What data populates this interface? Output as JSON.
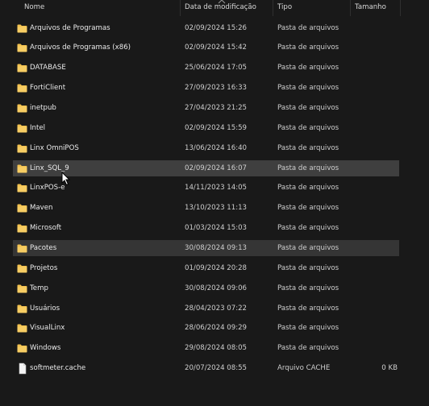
{
  "columns": {
    "name": "Nome",
    "date": "Data de modificação",
    "type": "Tipo",
    "size": "Tamanho"
  },
  "sort": {
    "column": "name",
    "icon": "chevron-up-icon"
  },
  "files": [
    {
      "name": "Arquivos de Programas",
      "date": "02/09/2024 15:26",
      "type": "Pasta de arquivos",
      "size": "",
      "icon": "folder-icon"
    },
    {
      "name": "Arquivos de Programas (x86)",
      "date": "02/09/2024 15:42",
      "type": "Pasta de arquivos",
      "size": "",
      "icon": "folder-icon"
    },
    {
      "name": "DATABASE",
      "date": "25/06/2024 17:05",
      "type": "Pasta de arquivos",
      "size": "",
      "icon": "folder-icon"
    },
    {
      "name": "FortiClient",
      "date": "27/09/2023 16:33",
      "type": "Pasta de arquivos",
      "size": "",
      "icon": "folder-icon"
    },
    {
      "name": "inetpub",
      "date": "27/04/2023 21:25",
      "type": "Pasta de arquivos",
      "size": "",
      "icon": "folder-icon"
    },
    {
      "name": "Intel",
      "date": "02/09/2024 15:59",
      "type": "Pasta de arquivos",
      "size": "",
      "icon": "folder-icon"
    },
    {
      "name": "Linx OmniPOS",
      "date": "13/06/2024 16:40",
      "type": "Pasta de arquivos",
      "size": "",
      "icon": "folder-icon"
    },
    {
      "name": "Linx_SQL_9",
      "date": "02/09/2024 16:07",
      "type": "Pasta de arquivos",
      "size": "",
      "icon": "folder-icon",
      "state": "hover"
    },
    {
      "name": "LinxPOS-e",
      "date": "14/11/2023 14:05",
      "type": "Pasta de arquivos",
      "size": "",
      "icon": "folder-icon"
    },
    {
      "name": "Maven",
      "date": "13/10/2023 11:13",
      "type": "Pasta de arquivos",
      "size": "",
      "icon": "folder-icon"
    },
    {
      "name": "Microsoft",
      "date": "01/03/2024 15:03",
      "type": "Pasta de arquivos",
      "size": "",
      "icon": "folder-icon"
    },
    {
      "name": "Pacotes",
      "date": "30/08/2024 09:13",
      "type": "Pasta de arquivos",
      "size": "",
      "icon": "folder-icon",
      "state": "selected"
    },
    {
      "name": "Projetos",
      "date": "01/09/2024 20:28",
      "type": "Pasta de arquivos",
      "size": "",
      "icon": "folder-icon"
    },
    {
      "name": "Temp",
      "date": "30/08/2024 09:06",
      "type": "Pasta de arquivos",
      "size": "",
      "icon": "folder-icon"
    },
    {
      "name": "Usuários",
      "date": "28/04/2023 07:22",
      "type": "Pasta de arquivos",
      "size": "",
      "icon": "folder-icon"
    },
    {
      "name": "VisualLinx",
      "date": "28/06/2024 09:29",
      "type": "Pasta de arquivos",
      "size": "",
      "icon": "folder-icon"
    },
    {
      "name": "Windows",
      "date": "29/08/2024 08:05",
      "type": "Pasta de arquivos",
      "size": "",
      "icon": "folder-icon"
    },
    {
      "name": "softmeter.cache",
      "date": "20/07/2024 08:55",
      "type": "Arquivo CACHE",
      "size": "0 KB",
      "icon": "file-icon"
    }
  ],
  "colors": {
    "background": "#191919",
    "hover_row": "#3f3f3f",
    "selected_row": "#353535",
    "folder": "#f2c14e"
  }
}
